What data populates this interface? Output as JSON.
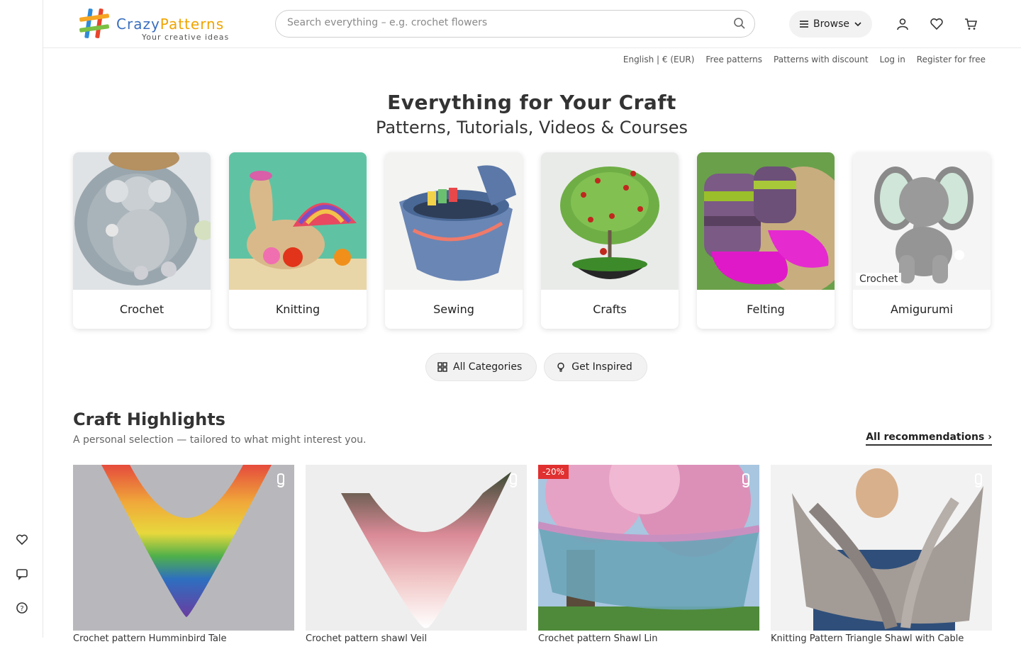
{
  "brand": {
    "name_a": "Crazy",
    "name_b": "Patterns",
    "tagline": "Your creative ideas"
  },
  "search": {
    "placeholder": "Search everything – e.g. crochet flowers"
  },
  "header": {
    "browse_label": "Browse"
  },
  "toplinks": [
    "English | € (EUR)",
    "Free patterns",
    "Patterns with discount",
    "Log in",
    "Register for free"
  ],
  "hero": {
    "title": "Everything for Your Craft",
    "subtitle": "Patterns, Tutorials, Videos & Courses"
  },
  "categories": [
    {
      "label": "Crochet"
    },
    {
      "label": "Knitting"
    },
    {
      "label": "Sewing"
    },
    {
      "label": "Crafts"
    },
    {
      "label": "Felting"
    },
    {
      "label": "Amigurumi",
      "badge": "Crochet"
    }
  ],
  "pills": {
    "all_categories": "All Categories",
    "get_inspired": "Get Inspired"
  },
  "highlights": {
    "title": "Craft Highlights",
    "subtitle": "A personal selection — tailored to what might interest you.",
    "link": "All recommendations"
  },
  "cards": [
    {
      "title": "Crochet pattern Humminbird Tale",
      "discount": ""
    },
    {
      "title": "Crochet pattern shawl Veil",
      "discount": ""
    },
    {
      "title": "Crochet pattern Shawl Lin",
      "discount": "-20%"
    },
    {
      "title": "Knitting Pattern Triangle Shawl with Cable",
      "discount": ""
    }
  ],
  "colors": {
    "brand_blue": "#3a6fbf",
    "brand_orange": "#f0a400",
    "discount_red": "#e03030"
  }
}
